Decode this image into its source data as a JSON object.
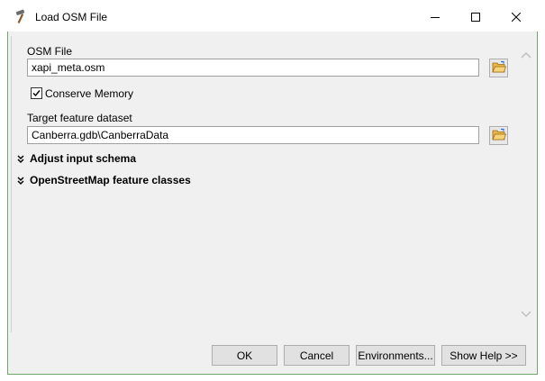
{
  "window": {
    "title": "Load OSM File",
    "app_icon": "hammer-icon",
    "minimize_icon": "minimize-icon",
    "maximize_icon": "maximize-icon",
    "close_icon": "close-icon"
  },
  "form": {
    "osm_file": {
      "label": "OSM File",
      "value": "xapi_meta.osm",
      "browse_icon": "open-folder-icon"
    },
    "conserve_memory": {
      "label": "Conserve Memory",
      "checked": true
    },
    "target_dataset": {
      "label": "Target feature dataset",
      "value": "Canberra.gdb\\CanberraData",
      "browse_icon": "open-folder-icon"
    },
    "sections": [
      {
        "label": "Adjust input schema",
        "icon": "double-chevron-down-icon"
      },
      {
        "label": "OpenStreetMap feature classes",
        "icon": "double-chevron-down-icon"
      }
    ]
  },
  "buttons": {
    "ok": "OK",
    "cancel": "Cancel",
    "environments": "Environments...",
    "show_help": "Show Help >>"
  },
  "colors": {
    "window_border": "#6fa66a",
    "dialog_bg": "#f0f0f0",
    "button_bg": "#e1e1e1"
  }
}
